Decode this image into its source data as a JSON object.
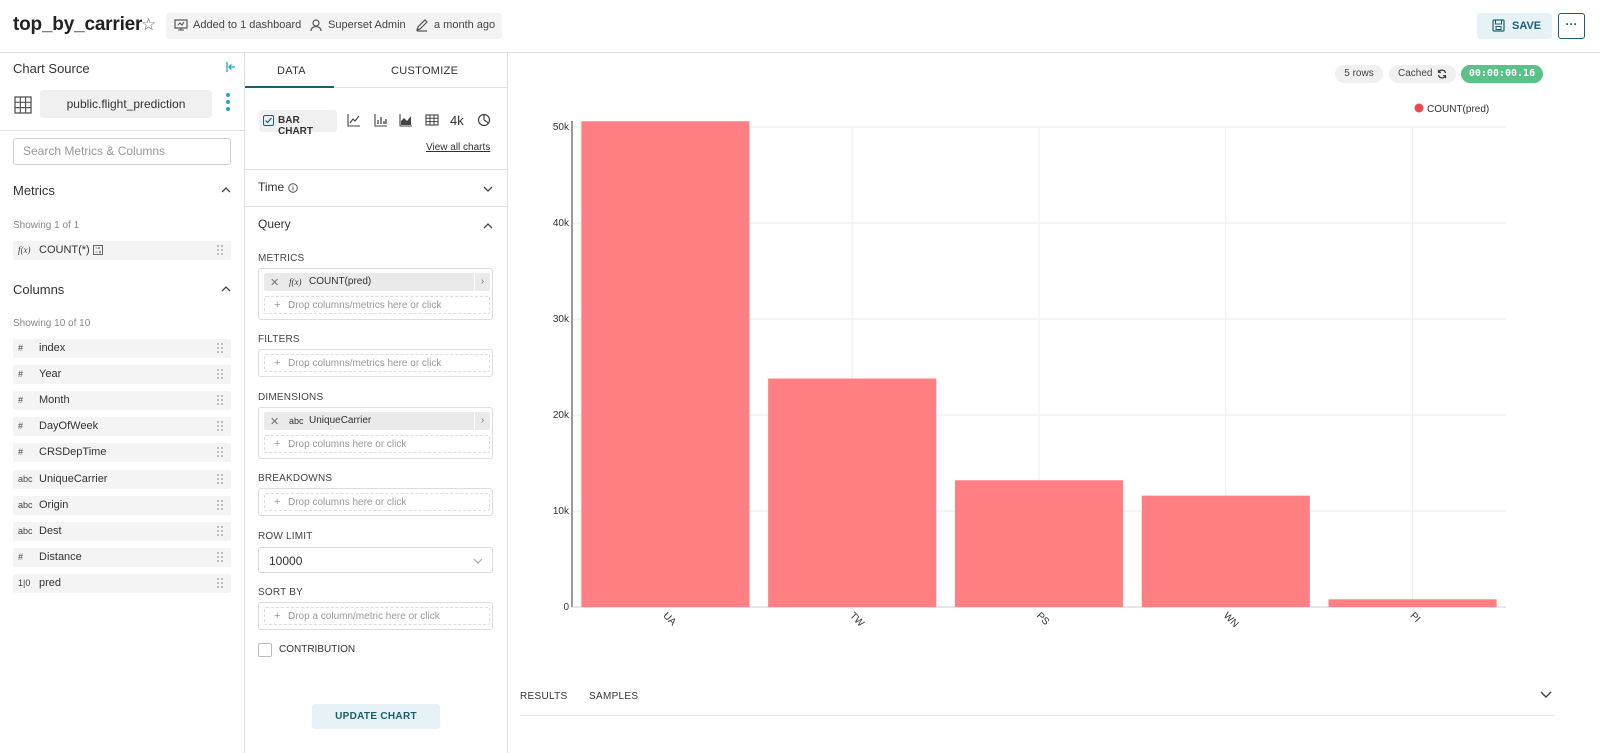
{
  "header": {
    "title": "top_by_carrier",
    "dashboards": "Added to 1 dashboard",
    "owner": "Superset Admin",
    "modified": "a month ago",
    "save_label": "SAVE",
    "more_label": "···"
  },
  "left": {
    "chart_source_label": "Chart Source",
    "datasource": "public.flight_prediction",
    "search_placeholder": "Search Metrics & Columns",
    "metrics_title": "Metrics",
    "metrics_showing": "Showing 1 of 1",
    "metrics": [
      {
        "type": "f(x)",
        "name": "COUNT(*)"
      }
    ],
    "columns_title": "Columns",
    "columns_showing": "Showing 10 of 10",
    "columns": [
      {
        "type": "#",
        "name": "index"
      },
      {
        "type": "#",
        "name": "Year"
      },
      {
        "type": "#",
        "name": "Month"
      },
      {
        "type": "#",
        "name": "DayOfWeek"
      },
      {
        "type": "#",
        "name": "CRSDepTime"
      },
      {
        "type": "abc",
        "name": "UniqueCarrier"
      },
      {
        "type": "abc",
        "name": "Origin"
      },
      {
        "type": "abc",
        "name": "Dest"
      },
      {
        "type": "#",
        "name": "Distance"
      },
      {
        "type": "1|0",
        "name": "pred"
      }
    ]
  },
  "mid": {
    "tab_data": "DATA",
    "tab_customize": "CUSTOMIZE",
    "viz_type": "BAR CHART",
    "viz_big_number": "4k",
    "view_all": "View all charts",
    "time_title": "Time",
    "query_title": "Query",
    "metrics_label": "METRICS",
    "metric_pill": {
      "type": "f(x)",
      "name": "COUNT(pred)"
    },
    "drop_metrics": "Drop columns/metrics here or click",
    "filters_label": "FILTERS",
    "drop_filters": "Drop columns/metrics here or click",
    "dimensions_label": "DIMENSIONS",
    "dimension_pill": {
      "type": "abc",
      "name": "UniqueCarrier"
    },
    "drop_dimensions": "Drop columns here or click",
    "breakdowns_label": "BREAKDOWNS",
    "drop_breakdowns": "Drop columns here or click",
    "row_limit_label": "ROW LIMIT",
    "row_limit_value": "10000",
    "sort_by_label": "SORT BY",
    "drop_sort": "Drop a column/metric here or click",
    "contribution_label": "CONTRIBUTION",
    "update_label": "UPDATE CHART"
  },
  "right": {
    "rows_badge": "5 rows",
    "cached_badge": "Cached",
    "timer": "00:00:00.16",
    "results_tab": "RESULTS",
    "samples_tab": "SAMPLES"
  },
  "colors": {
    "bar": "#ff7f83",
    "accent": "#1a5e73",
    "timer": "#5ac189"
  },
  "chart_data": {
    "type": "bar",
    "categories": [
      "UA",
      "TW",
      "PS",
      "WN",
      "PI"
    ],
    "series": [
      {
        "name": "COUNT(pred)",
        "values": [
          50600,
          23800,
          13200,
          11600,
          800
        ]
      }
    ],
    "ylim": [
      0,
      50000
    ],
    "yticks": [
      0,
      10000,
      20000,
      30000,
      40000,
      50000
    ],
    "ytick_labels": [
      "0",
      "10k",
      "20k",
      "30k",
      "40k",
      "50k"
    ],
    "legend_position": "top-right",
    "grid": true,
    "xlabel": "",
    "ylabel": ""
  }
}
